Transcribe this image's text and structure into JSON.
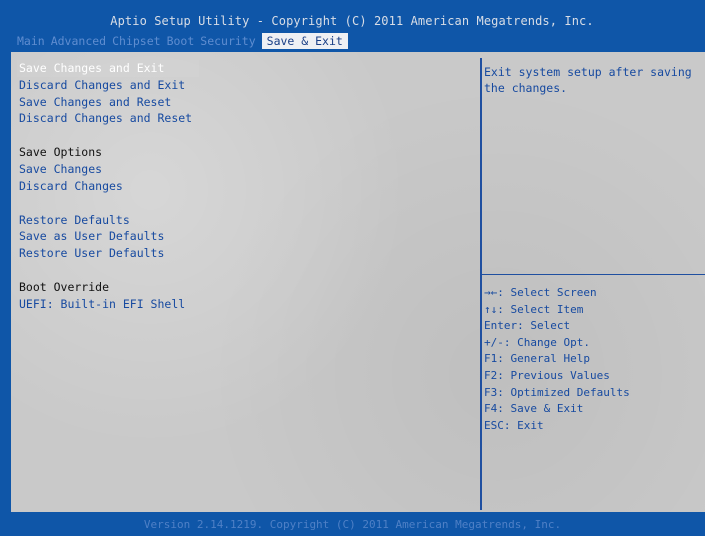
{
  "title": "Aptio Setup Utility - Copyright (C) 2011 American Megatrends, Inc.",
  "tabs": [
    {
      "label": "Main"
    },
    {
      "label": "Advanced"
    },
    {
      "label": "Chipset"
    },
    {
      "label": "Boot"
    },
    {
      "label": "Security"
    },
    {
      "label": "Save & Exit",
      "active": true
    }
  ],
  "menu": {
    "save_changes_and_exit": "Save Changes and Exit",
    "discard_changes_and_exit": "Discard Changes and Exit",
    "save_changes_and_reset": "Save Changes and Reset",
    "discard_changes_and_reset": "Discard Changes and Reset",
    "save_options_header": "Save Options",
    "save_changes": "Save Changes",
    "discard_changes": "Discard Changes",
    "restore_defaults": "Restore Defaults",
    "save_as_user_defaults": "Save as User Defaults",
    "restore_user_defaults": "Restore User Defaults",
    "boot_override_header": "Boot Override",
    "uefi_builtin_efi_shell": "UEFI: Built-in EFI Shell"
  },
  "help": {
    "description": "Exit system setup after saving the changes."
  },
  "keys": [
    "→←: Select Screen",
    "↑↓: Select Item",
    "Enter: Select",
    "+/-: Change Opt.",
    "F1: General Help",
    "F2: Previous Values",
    "F3: Optimized Defaults",
    "F4: Save & Exit",
    "ESC: Exit"
  ],
  "footer": "Version 2.14.1219. Copyright (C) 2011 American Megatrends, Inc.",
  "colors": {
    "frame_blue": "#0f56a8",
    "panel_gray": "#c9c9c9",
    "item_blue": "#174aa0",
    "selected_text": "#ffffff",
    "active_tab_bg": "#eef0f4"
  }
}
